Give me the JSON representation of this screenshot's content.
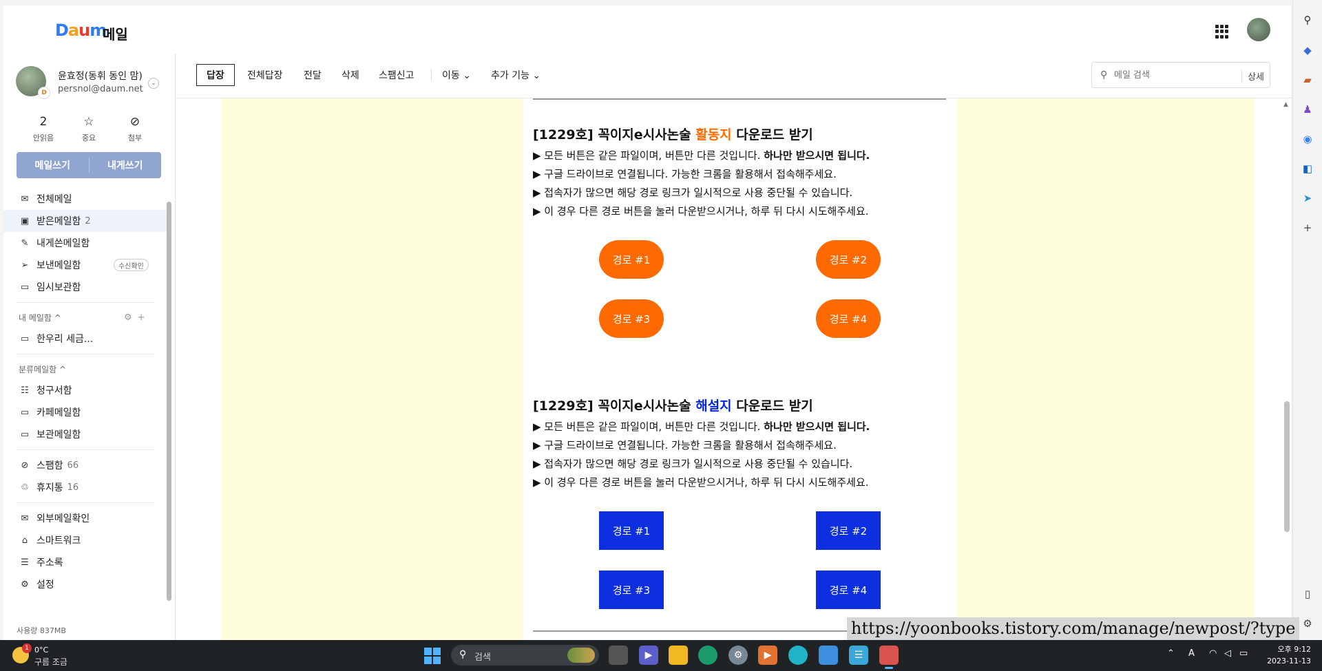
{
  "app": {
    "logo": "Daum",
    "title": "메일"
  },
  "profile": {
    "name": "윤효정(동휘 동인 맘)",
    "email": "persnol@daum.net",
    "badge": "D"
  },
  "quick": [
    {
      "value": "2",
      "label": "안읽음"
    },
    {
      "value": "☆",
      "label": "중요"
    },
    {
      "value": "⊘",
      "label": "첨부"
    }
  ],
  "compose": {
    "write": "메일쓰기",
    "self": "내게쓰기"
  },
  "nav": {
    "all": "전체메일",
    "inbox": "받은메일함",
    "inbox_count": "2",
    "toself": "내게쓴메일함",
    "sent": "보낸메일함",
    "sent_pill": "수신확인",
    "drafts": "임시보관함",
    "my_section": "내 메일함 ^",
    "folder1": "한우리 세금...",
    "cat_section": "분류메일함 ^",
    "bills": "청구서함",
    "cafe": "카페메일함",
    "archive": "보관메일함",
    "spam": "스팸함",
    "spam_count": "66",
    "trash": "휴지통",
    "trash_count": "16",
    "external": "외부메일확인",
    "smartwork": "스마트워크",
    "contacts": "주소록",
    "settings": "설정"
  },
  "usage": "사용량 837MB",
  "toolbar": {
    "reply": "답장",
    "reply_all": "전체답장",
    "forward": "전달",
    "delete": "삭제",
    "spam": "스팸신고",
    "move": "이동 ⌄",
    "more": "추가 기능 ⌄",
    "search_placeholder": "메일 검색",
    "detail": "상세"
  },
  "email": {
    "block1": {
      "title_pre": "[1229호] 꼭이지e시사논술 ",
      "title_hl": "활동지",
      "title_post": " 다운로드 받기",
      "line1": "▶ 모든 버튼은 같은 파일이며, 버튼만 다른 것입니다. ",
      "line1_bold": "하나만 받으시면 됩니다.",
      "line2": "▶ 구글 드라이브로 연결됩니다. 가능한 크롬을 활용해서 접속해주세요.",
      "line3": "▶ 접속자가 많으면 해당 경로 링크가 일시적으로 사용 중단될 수 있습니다.",
      "line4": "▶ 이 경우 다른 경로 버튼을 눌러 다운받으시거나, 하루 뒤 다시 시도해주세요.",
      "buttons": [
        "경로 #1",
        "경로 #2",
        "경로 #3",
        "경로 #4"
      ]
    },
    "block2": {
      "title_pre": "[1229호] 꼭이지e시사논술 ",
      "title_hl": "해설지",
      "title_post": " 다운로드 받기",
      "line1": "▶ 모든 버튼은 같은 파일이며, 버튼만 다른 것입니다. ",
      "line1_bold": "하나만 받으시면 됩니다.",
      "line2": "▶ 구글 드라이브로 연결됩니다. 가능한 크롬을 활용해서 접속해주세요.",
      "line3": "▶ 접속자가 많으면 해당 경로 링크가 일시적으로 사용 중단될 수 있습니다.",
      "line4": "▶ 이 경우 다른 경로 버튼을 눌러 다운받으시거나, 하루 뒤 다시 시도해주세요.",
      "buttons": [
        "경로 #1",
        "경로 #2",
        "경로 #3",
        "경로 #4"
      ]
    }
  },
  "url_overlay": "https://yoonbooks.tistory.com/manage/newpost/?type",
  "taskbar": {
    "weather_temp": "0°C",
    "weather_desc": "구름 조금",
    "weather_badge": "1",
    "search_label": "검색",
    "clock_time": "오후 9:12",
    "clock_date": "2023-11-13",
    "lang": "A"
  },
  "colors": {
    "accent_orange": "#ff6a00",
    "accent_blue": "#0e2fe0",
    "compose_bg": "#8fa5d0",
    "email_bg": "#fefedd"
  }
}
